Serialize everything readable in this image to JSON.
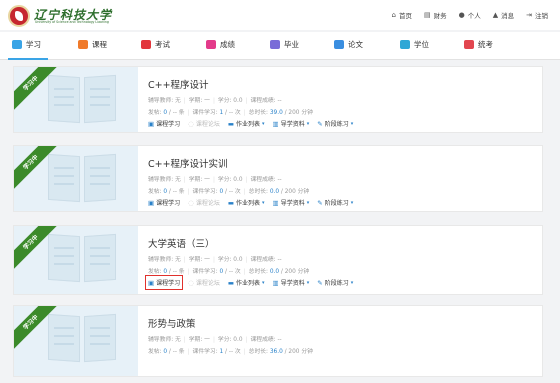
{
  "header": {
    "logo_name": "辽宁科技大学",
    "logo_en": "University of Science and Technology Liaoning",
    "nav": [
      {
        "label": "首页",
        "icon": "home-icon",
        "glyph": "⌂"
      },
      {
        "label": "财务",
        "icon": "finance-icon",
        "glyph": "▤"
      },
      {
        "label": "个人",
        "icon": "user-icon",
        "glyph": "●"
      },
      {
        "label": "消息",
        "icon": "bell-icon",
        "glyph": "▲"
      },
      {
        "label": "注销",
        "icon": "logout-icon",
        "glyph": "⇥"
      }
    ]
  },
  "tabs": [
    {
      "label": "学习",
      "color": "#3aa4e6",
      "active": true
    },
    {
      "label": "课程",
      "color": "#f07a2a"
    },
    {
      "label": "考试",
      "color": "#e2363c"
    },
    {
      "label": "成绩",
      "color": "#e33a8a"
    },
    {
      "label": "毕业",
      "color": "#7a6cd8"
    },
    {
      "label": "论文",
      "color": "#3a8ee0"
    },
    {
      "label": "学位",
      "color": "#2ea7d6"
    },
    {
      "label": "统考",
      "color": "#e2464f"
    }
  ],
  "status_ribbon": "学习中",
  "labels": {
    "tutor": "辅导教师: ",
    "hours": "学期: ",
    "credit": "学分: ",
    "grade": "课程成绩: ",
    "posts": "发帖: ",
    "posts_unit": " 条",
    "coursework": "课件学习: ",
    "coursework_unit": " 次",
    "duration": "总时长: ",
    "duration_unit": " 分钟"
  },
  "actions": {
    "study": "课程学习",
    "forum": "课程论坛",
    "homework": "作业列表",
    "guide": "导学资料",
    "practice": "阶段练习"
  },
  "courses": [
    {
      "title": "C++程序设计",
      "tutor": "无",
      "hours": "一",
      "credit": "0.0",
      "grade": "--",
      "posts": "0",
      "posts_sep": " / -- ",
      "coursework": "1",
      "coursework_sep": " / -- ",
      "duration": "39.0",
      "duration_total": " / 200 "
    },
    {
      "title": "C++程序设计实训",
      "tutor": "无",
      "hours": "一",
      "credit": "0.0",
      "grade": "--",
      "posts": "0",
      "posts_sep": " / -- ",
      "coursework": "0",
      "coursework_sep": " / -- ",
      "duration": "0.0",
      "duration_total": " / 200 "
    },
    {
      "title": "大学英语（三）",
      "tutor": "无",
      "hours": "一",
      "credit": "0.0",
      "grade": "--",
      "posts": "0",
      "posts_sep": " / -- ",
      "coursework": "0",
      "coursework_sep": " / -- ",
      "duration": "0.0",
      "duration_total": " / 200 "
    },
    {
      "title": "形势与政策",
      "tutor": "无",
      "hours": "一",
      "credit": "0.0",
      "grade": "--",
      "posts": "0",
      "posts_sep": " / -- ",
      "coursework": "1",
      "coursework_sep": " / -- ",
      "duration": "36.0",
      "duration_total": " / 200 "
    }
  ]
}
